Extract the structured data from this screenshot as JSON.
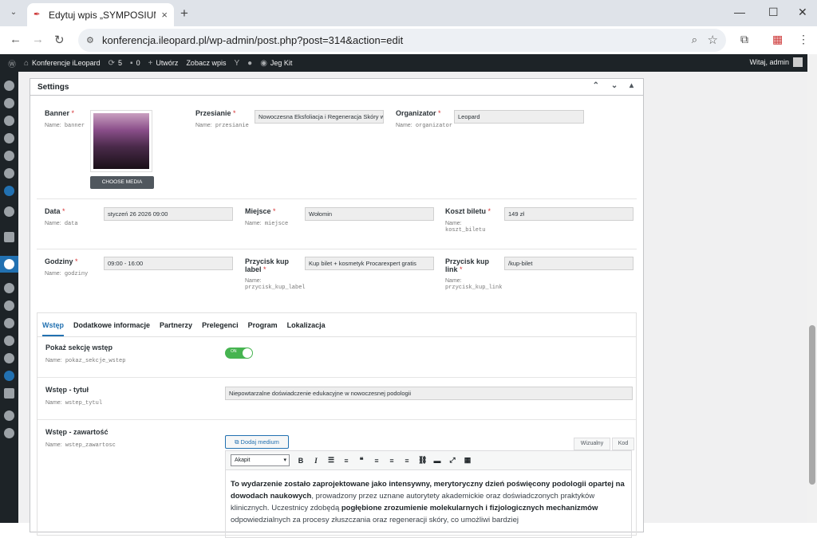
{
  "browser": {
    "tab_title": "Edytuj wpis „SYMPOSIUM PROC",
    "tab_close": "×",
    "new_tab": "+",
    "tab_menu": "⌄",
    "url": "konferencja.ileopard.pl/wp-admin/post.php?post=314&action=edit",
    "nav_back": "←",
    "nav_forward": "→",
    "nav_reload": "↻",
    "win_min": "—",
    "win_max": "☐",
    "win_close": "✕"
  },
  "adminbar": {
    "site": "Konferencje iLeopard",
    "updates": "5",
    "comments": "0",
    "new_label": "Utwórz",
    "view_label": "Zobacz wpis",
    "jeg": "Jeg Kit",
    "greeting": "Witaj, admin"
  },
  "settings": {
    "title": "Settings",
    "arrows": "⌃ ⌄ ▴",
    "fields": {
      "banner": {
        "label": "Banner",
        "name_prefix": "Name:",
        "name": "banner",
        "button": "CHOOSE MEDIA"
      },
      "przesianie": {
        "label": "Przesianie",
        "name_prefix": "Name:",
        "name": "przesianie",
        "value": "Nowoczesna Eksfoliacja i Regeneracja Skóry w"
      },
      "organizator": {
        "label": "Organizator",
        "name_prefix": "Name:",
        "name": "organizator",
        "value": "Leopard"
      },
      "data": {
        "label": "Data",
        "name_prefix": "Name:",
        "name": "data",
        "value": "styczeń 26 2026 09:00"
      },
      "miejsce": {
        "label": "Miejsce",
        "name_prefix": "Name:",
        "name": "miejsce",
        "value": "Wołomin"
      },
      "koszt": {
        "label": "Koszt biletu",
        "name_prefix": "Name:",
        "name": "koszt_biletu",
        "value": "149 zł"
      },
      "godziny": {
        "label": "Godziny",
        "name_prefix": "Name:",
        "name": "godziny",
        "value": "09:00 - 16:00"
      },
      "kup_label": {
        "label": "Przycisk kup label",
        "name_prefix": "Name:",
        "name": "przycisk_kup_label",
        "value": "Kup bilet + kosmetyk Procarexpert gratis"
      },
      "kup_link": {
        "label": "Przycisk kup link",
        "name_prefix": "Name:",
        "name": "przycisk_kup_link",
        "value": "/kup-bilet"
      }
    },
    "required": "*"
  },
  "tabs": [
    "Wstęp",
    "Dodatkowe informacje",
    "Partnerzy",
    "Prelegenci",
    "Program",
    "Lokalizacja"
  ],
  "wstep": {
    "show": {
      "label": "Pokaż sekcję wstęp",
      "name_prefix": "Name:",
      "name": "pokaz_sekcje_wstep",
      "toggle": "ON"
    },
    "title": {
      "label": "Wstęp - tytuł",
      "name_prefix": "Name:",
      "name": "wstep_tytul",
      "value": "Niepowtarzalne doświadczenie edukacyjne w nowoczesnej podologii"
    },
    "content": {
      "label": "Wstęp - zawartość",
      "name_prefix": "Name:",
      "name": "wstep_zawartosc",
      "media_btn": "Dodaj medium",
      "tab_visual": "Wizualny",
      "tab_code": "Kod",
      "format": "Akapit"
    },
    "body": {
      "b1": "To wydarzenie zostało zaprojektowane jako intensywny, merytoryczny dzień poświęcony podologii opartej na dowodach naukowych",
      "t1": ", prowadzony przez uznane autorytety akademickie oraz doświadczonych praktyków klinicznych. Uczestnicy zdobędą ",
      "b2": "pogłębione zrozumienie molekularnych i fizjologicznych mechanizmów",
      "t2": " odpowiedzialnych za procesy złuszczania oraz regeneracji skóry, co umożliwi bardziej"
    }
  }
}
